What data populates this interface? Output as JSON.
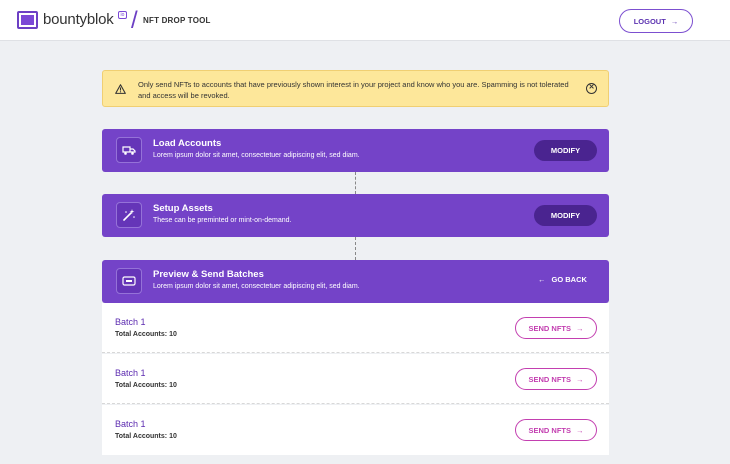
{
  "header": {
    "logo_text": "bountyblok",
    "logo_badge": "io",
    "separator": "/",
    "tool_title": "NFT DROP TOOL",
    "logout_label": "LOGOUT",
    "logout_arrow": "→"
  },
  "alert": {
    "text": "Only send NFTs to accounts that have previously shown interest in your project and know who you are. Spamming is not tolerated and access will be revoked.",
    "close_glyph": "✕"
  },
  "steps": [
    {
      "title": "Load Accounts",
      "subtitle": "Lorem ipsum dolor sit amet, consectetuer adipiscing elit, sed diam.",
      "action_label": "MODIFY"
    },
    {
      "title": "Setup Assets",
      "subtitle": "These can be preminted or mint-on-demand.",
      "action_label": "MODIFY"
    },
    {
      "title": "Preview & Send Batches",
      "subtitle": "Lorem ipsum dolor sit amet, consectetuer adipiscing elit, sed diam.",
      "action_label": "GO BACK",
      "action_arrow": "←"
    }
  ],
  "batches": [
    {
      "name": "Batch 1",
      "accounts_label": "Total Accounts:",
      "accounts_count": "10",
      "send_label": "SEND NFTS",
      "send_arrow": "→"
    },
    {
      "name": "Batch 1",
      "accounts_label": "Total Accounts:",
      "accounts_count": "10",
      "send_label": "SEND NFTS",
      "send_arrow": "→"
    },
    {
      "name": "Batch 1",
      "accounts_label": "Total Accounts:",
      "accounts_count": "10",
      "send_label": "SEND NFTS",
      "send_arrow": "→"
    }
  ],
  "colors": {
    "accent": "#7443c8",
    "accent_dark": "#4a2490",
    "send": "#c33fb0",
    "alert_bg": "#fde79a"
  },
  "icons": [
    "warning-icon",
    "close-circle-icon",
    "truck-icon",
    "magic-wand-icon",
    "ticket-icon",
    "arrow-right-icon",
    "arrow-left-icon"
  ]
}
